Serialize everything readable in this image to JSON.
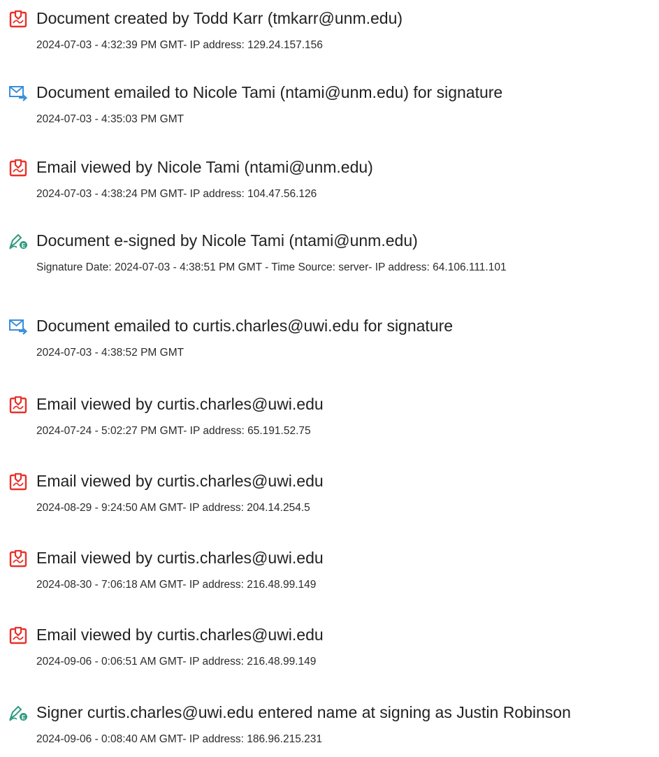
{
  "audit_trail": {
    "events": [
      {
        "icon": "document-created-icon",
        "title": "Document created by Todd Karr (tmkarr@unm.edu)",
        "detail": "2024-07-03 - 4:32:39 PM GMT- IP address: 129.24.157.156"
      },
      {
        "icon": "email-sent-icon",
        "title": "Document emailed to Nicole Tami (ntami@unm.edu) for signature",
        "detail": "2024-07-03 - 4:35:03 PM GMT"
      },
      {
        "icon": "document-viewed-icon",
        "title": "Email viewed by Nicole Tami (ntami@unm.edu)",
        "detail": "2024-07-03 - 4:38:24 PM GMT- IP address: 104.47.56.126"
      },
      {
        "icon": "e-sign-icon",
        "title": "Document e-signed by Nicole Tami (ntami@unm.edu)",
        "detail": "Signature Date: 2024-07-03 - 4:38:51 PM GMT - Time Source: server- IP address: 64.106.111.101"
      },
      {
        "icon": "email-sent-icon",
        "title": "Document emailed to curtis.charles@uwi.edu for signature",
        "detail": "2024-07-03 - 4:38:52 PM GMT"
      },
      {
        "icon": "document-viewed-icon",
        "title": "Email viewed by curtis.charles@uwi.edu",
        "detail": "2024-07-24 - 5:02:27 PM GMT- IP address: 65.191.52.75"
      },
      {
        "icon": "document-viewed-icon",
        "title": "Email viewed by curtis.charles@uwi.edu",
        "detail": "2024-08-29 - 9:24:50 AM GMT- IP address: 204.14.254.5"
      },
      {
        "icon": "document-viewed-icon",
        "title": "Email viewed by curtis.charles@uwi.edu",
        "detail": "2024-08-30 - 7:06:18 AM GMT- IP address: 216.48.99.149"
      },
      {
        "icon": "document-viewed-icon",
        "title": "Email viewed by curtis.charles@uwi.edu",
        "detail": "2024-09-06 - 0:06:51 AM GMT- IP address: 216.48.99.149"
      },
      {
        "icon": "e-sign-icon",
        "title": "Signer curtis.charles@uwi.edu entered name at signing as Justin Robinson",
        "detail": "2024-09-06 - 0:08:40 AM GMT- IP address: 186.96.215.231"
      }
    ]
  },
  "colors": {
    "document_icon": "#e8312a",
    "email_icon": "#3a8fd8",
    "sign_icon": "#2f9a7f",
    "text": "#222222"
  }
}
